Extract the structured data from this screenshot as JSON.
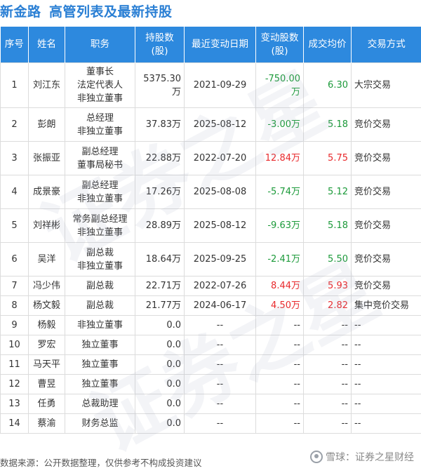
{
  "title": {
    "company": "新金路",
    "subtitle": "高管列表及最新持股"
  },
  "colors": {
    "header_bg": "#2d89de",
    "positive": "#e8292c",
    "negative": "#1c9a3a",
    "title": "#2a7fd4"
  },
  "columns": [
    "序号",
    "姓名",
    "职务",
    "持股数\n(股)",
    "最近变动日期",
    "变动股数\n(股)",
    "成交均价",
    "交易方式"
  ],
  "rows": [
    {
      "no": "1",
      "name": "刘江东",
      "position": [
        "董事长",
        "法定代表人",
        "非独立董事"
      ],
      "shares": "5375.30万",
      "date": "2021-09-29",
      "change": "-750.00万",
      "change_sign": "neg",
      "price": "6.30",
      "price_sign": "neg",
      "method": "大宗交易"
    },
    {
      "no": "2",
      "name": "彭朗",
      "position": [
        "总经理",
        "非独立董事"
      ],
      "shares": "37.83万",
      "date": "2025-08-12",
      "change": "-3.00万",
      "change_sign": "neg",
      "price": "5.18",
      "price_sign": "neg",
      "method": "竞价交易"
    },
    {
      "no": "3",
      "name": "张振亚",
      "position": [
        "副总经理",
        "董事局秘书"
      ],
      "shares": "22.88万",
      "date": "2022-07-20",
      "change": "12.84万",
      "change_sign": "pos",
      "price": "5.75",
      "price_sign": "pos",
      "method": "竞价交易"
    },
    {
      "no": "4",
      "name": "成景豪",
      "position": [
        "副总经理",
        "非独立董事"
      ],
      "shares": "17.26万",
      "date": "2025-08-08",
      "change": "-5.74万",
      "change_sign": "neg",
      "price": "5.12",
      "price_sign": "neg",
      "method": "竞价交易"
    },
    {
      "no": "5",
      "name": "刘祥彬",
      "position": [
        "常务副总经理",
        "非独立董事"
      ],
      "shares": "28.89万",
      "date": "2025-08-12",
      "change": "-9.63万",
      "change_sign": "neg",
      "price": "5.18",
      "price_sign": "neg",
      "method": "竞价交易"
    },
    {
      "no": "6",
      "name": "吴洋",
      "position": [
        "副总裁",
        "非独立董事"
      ],
      "shares": "18.64万",
      "date": "2025-09-25",
      "change": "-2.41万",
      "change_sign": "neg",
      "price": "5.50",
      "price_sign": "neg",
      "method": "竞价交易"
    },
    {
      "no": "7",
      "name": "冯少伟",
      "position": [
        "副总裁"
      ],
      "shares": "22.71万",
      "date": "2022-07-26",
      "change": "8.44万",
      "change_sign": "pos",
      "price": "5.93",
      "price_sign": "pos",
      "method": "竞价交易"
    },
    {
      "no": "8",
      "name": "杨文毅",
      "position": [
        "副总裁"
      ],
      "shares": "21.77万",
      "date": "2024-06-17",
      "change": "4.50万",
      "change_sign": "pos",
      "price": "2.82",
      "price_sign": "pos",
      "method": "集中竞价交易"
    },
    {
      "no": "9",
      "name": "杨毅",
      "position": [
        "非独立董事"
      ],
      "shares": "0.0",
      "date": "--",
      "change": "--",
      "change_sign": "none",
      "price": "--",
      "price_sign": "none",
      "method": "--"
    },
    {
      "no": "10",
      "name": "罗宏",
      "position": [
        "独立董事"
      ],
      "shares": "0.0",
      "date": "--",
      "change": "--",
      "change_sign": "none",
      "price": "--",
      "price_sign": "none",
      "method": "--"
    },
    {
      "no": "11",
      "name": "马天平",
      "position": [
        "独立董事"
      ],
      "shares": "0.0",
      "date": "--",
      "change": "--",
      "change_sign": "none",
      "price": "--",
      "price_sign": "none",
      "method": "--"
    },
    {
      "no": "12",
      "name": "曹昱",
      "position": [
        "独立董事"
      ],
      "shares": "0.0",
      "date": "--",
      "change": "--",
      "change_sign": "none",
      "price": "--",
      "price_sign": "none",
      "method": "--"
    },
    {
      "no": "13",
      "name": "任勇",
      "position": [
        "总裁助理"
      ],
      "shares": "0.0",
      "date": "--",
      "change": "--",
      "change_sign": "none",
      "price": "--",
      "price_sign": "none",
      "method": "--"
    },
    {
      "no": "14",
      "name": "蔡渝",
      "position": [
        "财务总监"
      ],
      "shares": "0.0",
      "date": "--",
      "change": "--",
      "change_sign": "none",
      "price": "--",
      "price_sign": "none",
      "method": "--"
    }
  ],
  "footer": {
    "source": "数据来源：公开数据整理，仅供参考不构成投资建议",
    "brand": "雪球：证券之星财经"
  },
  "watermark": "证券之星"
}
